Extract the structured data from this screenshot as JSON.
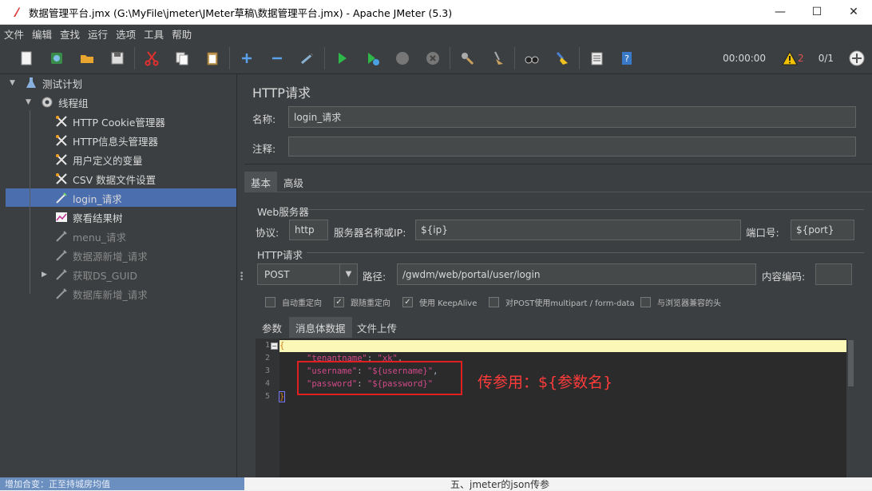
{
  "window": {
    "title": "数据管理平台.jmx (G:\\MyFile\\jmeter\\JMeter草稿\\数据管理平台.jmx) - Apache JMeter (5.3)",
    "minimize": "—",
    "maximize": "☐",
    "close": "✕"
  },
  "menu": [
    "文件",
    "编辑",
    "查找",
    "运行",
    "选项",
    "工具",
    "帮助"
  ],
  "toolbar": {
    "timer": "00:00:00",
    "warning_count": "2",
    "threads": "0/1"
  },
  "tree": {
    "test_plan": "测试计划",
    "thread_group": "线程组",
    "items": [
      {
        "label": "HTTP Cookie管理器",
        "icon": "tool-icon",
        "disabled": false
      },
      {
        "label": "HTTP信息头管理器",
        "icon": "tool-icon",
        "disabled": false
      },
      {
        "label": "用户定义的变量",
        "icon": "tool-icon",
        "disabled": false
      },
      {
        "label": "CSV 数据文件设置",
        "icon": "tool-icon",
        "disabled": false
      },
      {
        "label": "login_请求",
        "icon": "pipette-icon",
        "disabled": false
      },
      {
        "label": "察看结果树",
        "icon": "chart-icon",
        "disabled": false
      },
      {
        "label": "menu_请求",
        "icon": "pipette-icon",
        "disabled": true
      },
      {
        "label": "数据源新增_请求",
        "icon": "pipette-icon",
        "disabled": true
      },
      {
        "label": "获取DS_GUID",
        "icon": "pipette-icon",
        "disabled": true
      },
      {
        "label": "数据库新增_请求",
        "icon": "pipette-icon",
        "disabled": true
      }
    ]
  },
  "panel": {
    "title": "HTTP请求",
    "name_label": "名称:",
    "name_value": "login_请求",
    "comment_label": "注释:",
    "comment_value": "",
    "tabs": [
      "基本",
      "高级"
    ],
    "web_server": {
      "group_label": "Web服务器",
      "protocol_label": "协议:",
      "protocol_value": "http",
      "server_label": "服务器名称或IP:",
      "server_value": "${ip}",
      "port_label": "端口号:",
      "port_value": "${port}"
    },
    "http_request": {
      "group_label": "HTTP请求",
      "method": "POST",
      "path_label": "路径:",
      "path_value": "/gwdm/web/portal/user/login",
      "encoding_label": "内容编码:",
      "encoding_value": ""
    },
    "checkboxes": [
      {
        "label": "自动重定向",
        "checked": false
      },
      {
        "label": "跟随重定向",
        "checked": true
      },
      {
        "label": "使用 KeepAlive",
        "checked": true
      },
      {
        "label": "对POST使用multipart / form-data",
        "checked": false
      },
      {
        "label": "与浏览器兼容的头",
        "checked": false
      }
    ],
    "body_tabs": [
      "参数",
      "消息体数据",
      "文件上传"
    ],
    "editor": {
      "line_numbers": [
        "1",
        "2",
        "3",
        "4",
        "5"
      ],
      "line1": "{",
      "line2_key": "\"tenantname\"",
      "line2_val": "\"xk\"",
      "line3_key": "\"username\"",
      "line3_val": "\"${username}\"",
      "line4_key": "\"password\"",
      "line4_val": "\"${password}\"",
      "line5": "}"
    },
    "annotation": "传参用：${参数名}"
  },
  "background": {
    "bottom_left": "增加合变：正至持城房均值",
    "bottom_right": "五、jmeter的json传参"
  },
  "colors": {
    "panel_bg": "#3c3f41",
    "selection": "#4b6eaf",
    "annotation_red": "#ff3b3b"
  }
}
